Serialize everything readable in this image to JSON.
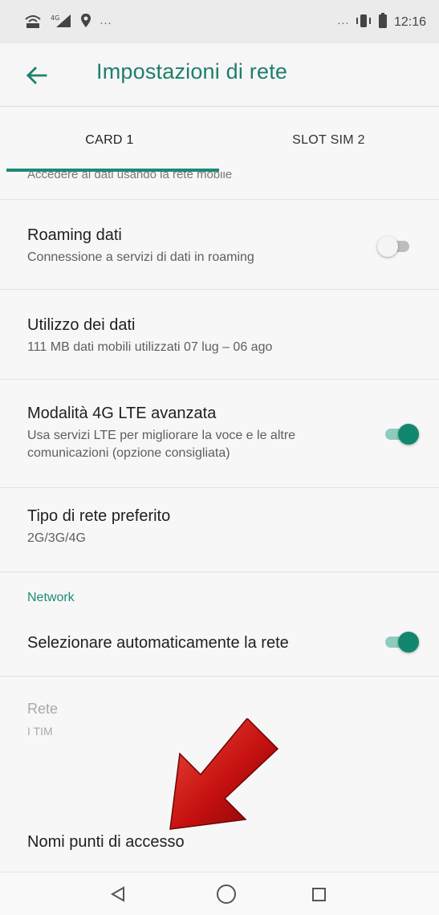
{
  "status_bar": {
    "time": "12:16",
    "left_icons": [
      "wifi-calling-icon",
      "signal-4g-icon",
      "location-icon",
      "more-notifications-icon"
    ],
    "right_icons": [
      "more-icon",
      "vibrate-icon",
      "battery-icon"
    ],
    "dots": "···",
    "signal_label": "4G"
  },
  "app_bar": {
    "title": "Impostazioni di rete",
    "back_icon": "arrow-back-icon",
    "accent": "#1d7f6e"
  },
  "tabs": [
    {
      "label": "CARD 1",
      "selected": true
    },
    {
      "label": "SLOT SIM 2",
      "selected": false
    }
  ],
  "cut_off_text": "Accedere ai dati usando la rete mobile",
  "settings": [
    {
      "title": "Roaming dati",
      "subtitle": "Connessione a servizi di dati in roaming",
      "switch": "off"
    },
    {
      "title": "Utilizzo dei dati",
      "subtitle": "111 MB dati mobili utilizzati 07 lug – 06 ago"
    },
    {
      "title": "Modalità 4G LTE avanzata",
      "subtitle": "Usa servizi LTE per migliorare la voce e le altre comunicazioni (opzione consigliata)",
      "switch": "on"
    },
    {
      "title": "Tipo di rete preferito",
      "subtitle": "2G/3G/4G"
    }
  ],
  "network_section": {
    "header": "Network",
    "auto_select": {
      "title": "Selezionare automaticamente la rete",
      "switch": "on"
    },
    "network": {
      "title": "Rete",
      "subtitle": "I TIM",
      "enabled": false
    },
    "apn": {
      "title": "Nomi punti di accesso"
    }
  },
  "annotation_arrow": {
    "color": "#c41010",
    "points_to": "Nomi punti di accesso"
  },
  "nav_bar": {
    "buttons": [
      "back-triangle-icon",
      "home-circle-icon",
      "recents-square-icon"
    ]
  }
}
